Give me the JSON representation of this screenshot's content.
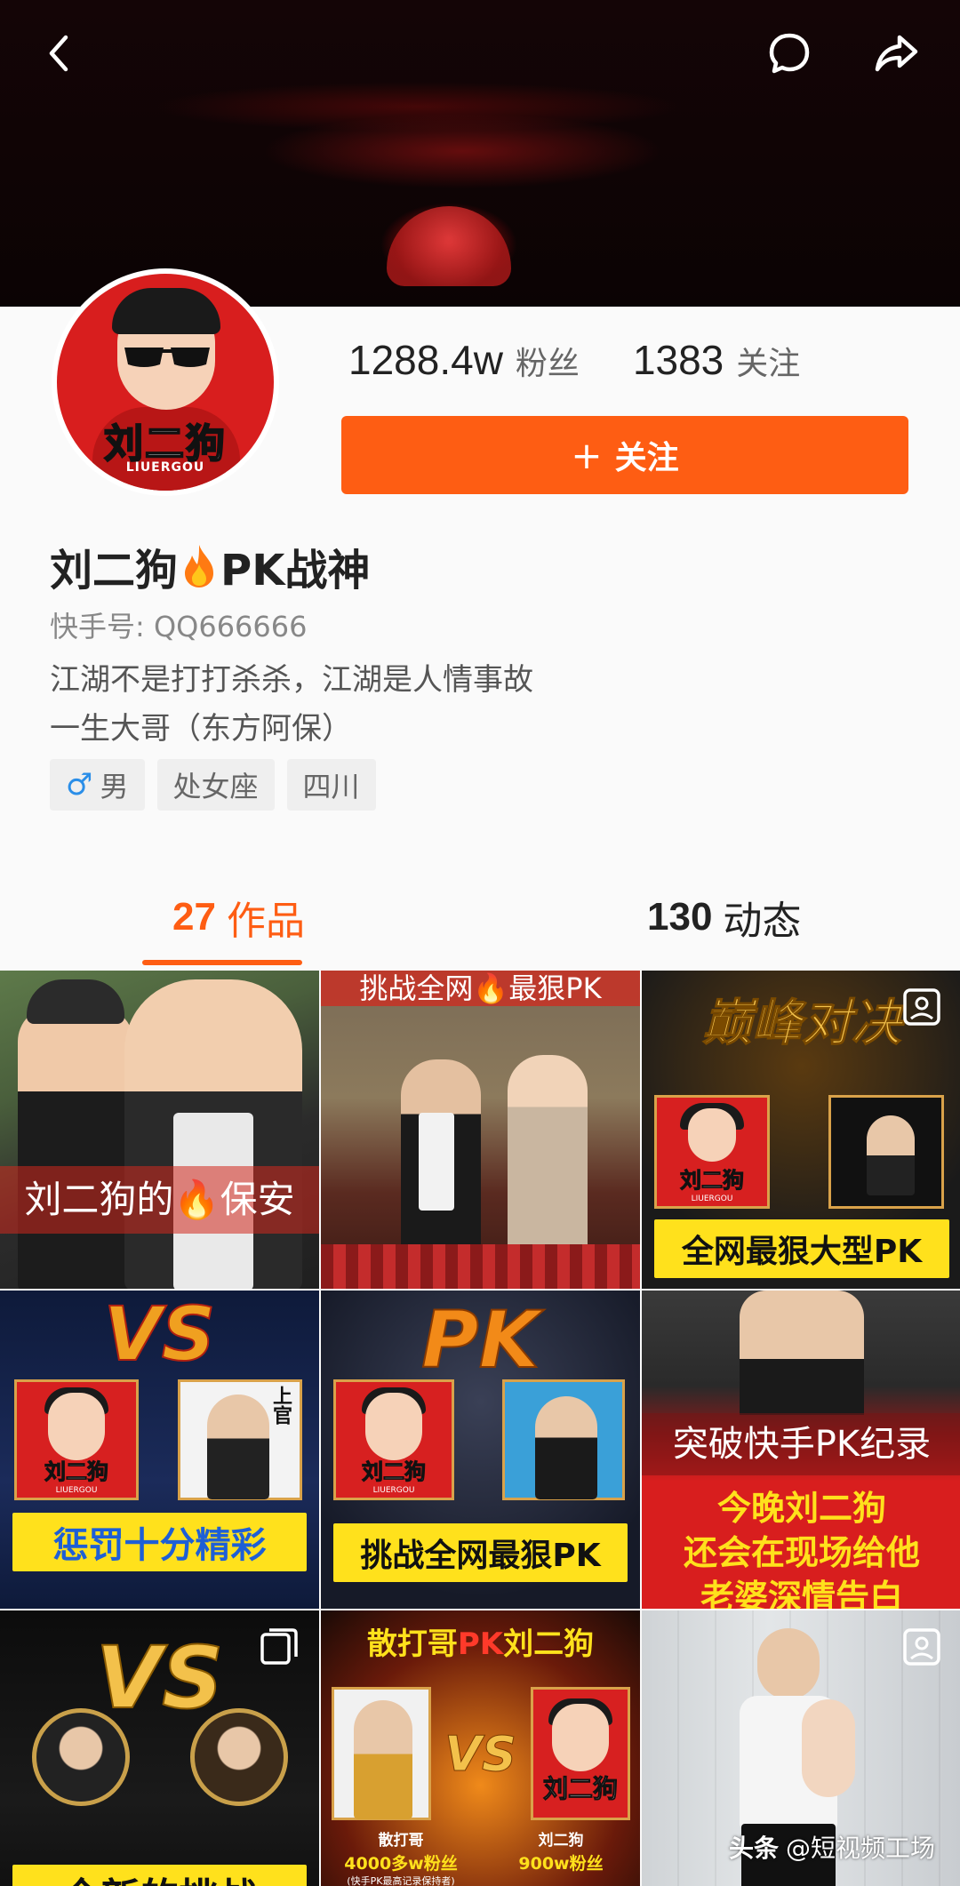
{
  "header": {
    "back_icon": "chevron-left-icon",
    "message_icon": "chat-bubble-icon",
    "share_icon": "share-arrow-icon"
  },
  "profile": {
    "avatar_name": "刘二狗",
    "avatar_sub": "LIUERGOU",
    "followers_count": "1288.4w",
    "followers_label": "粉丝",
    "following_count": "1383",
    "following_label": "关注",
    "follow_button_plus": "+",
    "follow_button_label": "关注",
    "display_name_prefix": "刘二狗",
    "display_name_suffix": "PK战神",
    "kuaishou_id": "快手号: QQ666666",
    "bio_line1": "江湖不是打打杀杀，江湖是人情事故",
    "bio_line2": "一生大哥（东方阿保）",
    "tags": {
      "gender_symbol": "♂",
      "gender": "男",
      "zodiac": "处女座",
      "location": "四川"
    }
  },
  "tabs": {
    "works_count": "27",
    "works_label": "作品",
    "moments_count": "130",
    "moments_label": "动态"
  },
  "grid": {
    "c1": {
      "caption": "刘二狗的🔥保安"
    },
    "c2": {
      "caption": "挑战全网🔥最狠PK"
    },
    "c3": {
      "title": "巅峰对决",
      "card_name": "刘二狗",
      "card_sub": "LIUERGOU",
      "bar": "全网最狠大型PK"
    },
    "c4": {
      "vs": "VS",
      "card_name": "刘二狗",
      "card_sub": "LIUERGOU",
      "side_text": "上官",
      "bar": "惩罚十分精彩"
    },
    "c5": {
      "title": "PK",
      "card_name": "刘二狗",
      "card_sub": "LIUERGOU",
      "bar": "挑战全网最狠PK"
    },
    "c6": {
      "line1": "突破快手PK纪录",
      "line2": "今晚刘二狗",
      "line3": "还会在现场给他",
      "line4": "老婆深情告白"
    },
    "c7": {
      "vs": "VS",
      "bar": "全新的挑战"
    },
    "c8": {
      "title_a": "散打哥",
      "title_pk": "PK",
      "title_b": "刘二狗",
      "vs": "VS",
      "left_name": "散打哥",
      "left_fans": "4000多w粉丝",
      "left_note": "(快手PK最高记录保持者)",
      "right_card": "刘二狗",
      "right_name": "刘二狗",
      "right_fans": "900w粉丝"
    },
    "c9": {}
  },
  "watermark": {
    "brand": "头条",
    "text": "@短视频工场"
  },
  "colors": {
    "accent": "#fe5d13",
    "bar_yellow": "#ffe11c",
    "card_red": "#d72020"
  }
}
